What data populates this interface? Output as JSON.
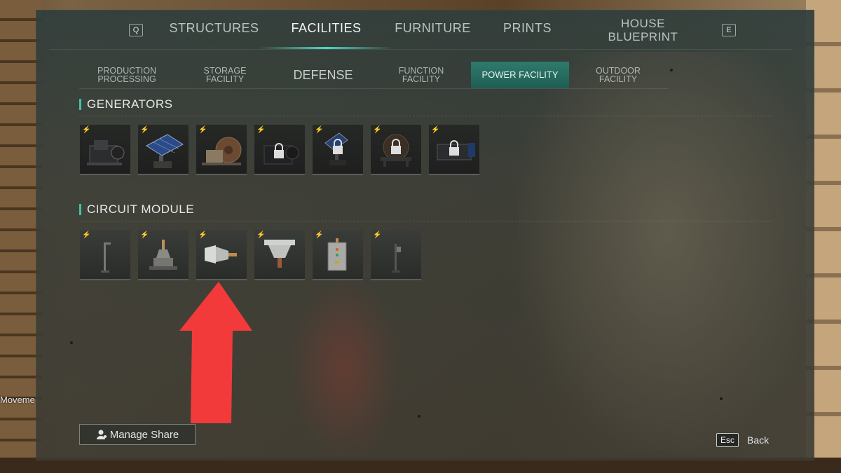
{
  "background": {
    "movement_label": "Moveme"
  },
  "top_nav": {
    "left_key": "Q",
    "right_key": "E",
    "tabs": [
      {
        "label": "STRUCTURES",
        "active": false
      },
      {
        "label": "FACILITIES",
        "active": true
      },
      {
        "label": "FURNITURE",
        "active": false
      },
      {
        "label": "PRINTS",
        "active": false
      },
      {
        "label_line1": "HOUSE",
        "label_line2": "BLUEPRINT",
        "active": false
      }
    ]
  },
  "sub_nav": {
    "tabs": [
      {
        "line1": "PRODUCTION",
        "line2": "PROCESSING",
        "active": false
      },
      {
        "line1": "STORAGE",
        "line2": "FACILITY",
        "active": false
      },
      {
        "line1": "DEFENSE",
        "line2": "",
        "active": false
      },
      {
        "line1": "FUNCTION",
        "line2": "FACILITY",
        "active": false
      },
      {
        "line1": "POWER FACILITY",
        "line2": "",
        "active": true
      },
      {
        "line1": "OUTDOOR",
        "line2": "FACILITY",
        "active": false
      }
    ]
  },
  "sections": {
    "generators": {
      "title": "GENERATORS",
      "items": [
        {
          "icon": "generator-engine-icon",
          "locked": false
        },
        {
          "icon": "solar-panel-icon",
          "locked": false
        },
        {
          "icon": "water-wheel-generator-icon",
          "locked": false
        },
        {
          "icon": "generator-engine-icon",
          "locked": true
        },
        {
          "icon": "solar-panel-icon",
          "locked": true
        },
        {
          "icon": "water-wheel-generator-icon",
          "locked": true
        },
        {
          "icon": "generator-engine-icon",
          "locked": true
        }
      ]
    },
    "circuit_module": {
      "title": "CIRCUIT MODULE",
      "items": [
        {
          "icon": "lamp-post-icon"
        },
        {
          "icon": "insulator-icon"
        },
        {
          "icon": "wall-connector-icon"
        },
        {
          "icon": "ceiling-connector-icon"
        },
        {
          "icon": "switch-box-icon"
        },
        {
          "icon": "pole-switch-icon"
        }
      ]
    }
  },
  "footer": {
    "manage_share_label": "Manage Share",
    "esc_key": "Esc",
    "back_label": "Back"
  },
  "annotation": {
    "arrow_color": "#f23a3a"
  },
  "colors": {
    "accent": "#3fc3ac",
    "active_tab": "#2f7a6d"
  }
}
